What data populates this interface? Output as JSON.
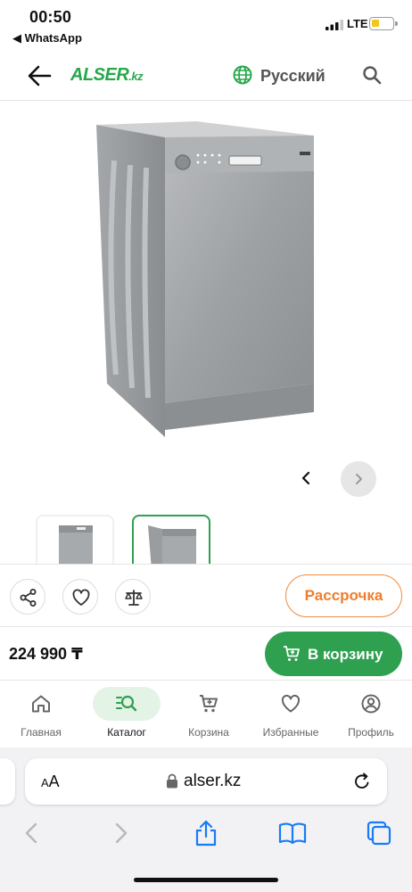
{
  "status_bar": {
    "time": "00:50",
    "back_app": "◀ WhatsApp",
    "network": "LTE"
  },
  "header": {
    "logo_main": "ALSER",
    "logo_suffix": ".kz",
    "language": "Русский",
    "accent_color": "#27a84a"
  },
  "gallery": {
    "prev_icon": "chevron-left-icon",
    "next_icon": "chevron-right-icon"
  },
  "actions": {
    "share_icon": "share-icon",
    "favorite_icon": "heart-icon",
    "compare_icon": "scales-icon",
    "installment_label": "Рассрочка",
    "installment_color": "#ef7d2b"
  },
  "purchase": {
    "price": "224 990 ₸",
    "add_to_cart_label": "В корзину",
    "button_color": "#2ea04f"
  },
  "bottom_nav": {
    "items": [
      {
        "label": "Главная",
        "icon": "home-icon"
      },
      {
        "label": "Каталог",
        "icon": "catalog-search-icon",
        "active": true
      },
      {
        "label": "Корзина",
        "icon": "cart-icon"
      },
      {
        "label": "Избранные",
        "icon": "heart-icon"
      },
      {
        "label": "Профиль",
        "icon": "profile-icon"
      }
    ]
  },
  "browser": {
    "text_size_label_small": "A",
    "text_size_label_large": "A",
    "url_host": "alser.kz"
  }
}
